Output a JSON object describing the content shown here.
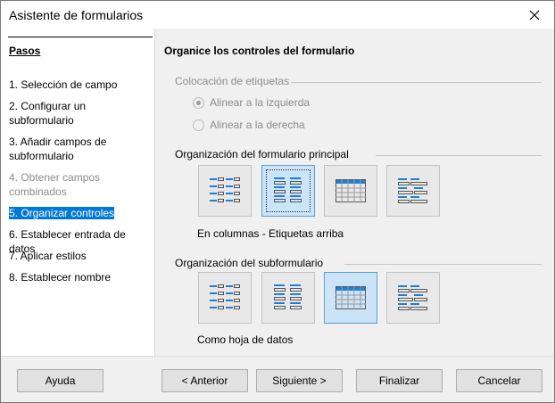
{
  "window": {
    "title": "Asistente de formularios"
  },
  "sidebar": {
    "heading": "Pasos",
    "steps": [
      {
        "label": "1. Selección de campo"
      },
      {
        "label": "2. Configurar un\nsubformulario"
      },
      {
        "label": "3. Añadir campos de\nsubformulario"
      },
      {
        "label": "4. Obtener campos\ncombinados"
      },
      {
        "label": "5. Organizar controles"
      },
      {
        "label": "6. Establecer entrada de datos"
      },
      {
        "label": "7. Aplicar estilos"
      },
      {
        "label": "8. Establecer nombre"
      }
    ],
    "selected_index": 4,
    "disabled_index": 3
  },
  "main": {
    "heading": "Organice los controles del formulario",
    "label_placement": {
      "title": "Colocación de etiquetas",
      "option_left": "Alinear a la izquierda",
      "option_right": "Alinear a la derecha",
      "selected": "left"
    },
    "main_form": {
      "title": "Organización del formulario principal",
      "caption": "En columnas - Etiquetas arriba",
      "selected_index": 1
    },
    "sub_form": {
      "title": "Organización del subformulario",
      "caption": "Como hoja de datos",
      "selected_index": 2
    },
    "layouts": [
      "columns-labels-left",
      "columns-labels-top",
      "datasheet",
      "blocks-labels-above"
    ]
  },
  "footer": {
    "help": "Ayuda",
    "back": "< Anterior",
    "next": "Siguiente >",
    "finish": "Finalizar",
    "cancel": "Cancelar"
  },
  "colors": {
    "selection": "#0078d7",
    "icon_blue": "#1f7fd6",
    "disabled": "#8c8c8c"
  }
}
